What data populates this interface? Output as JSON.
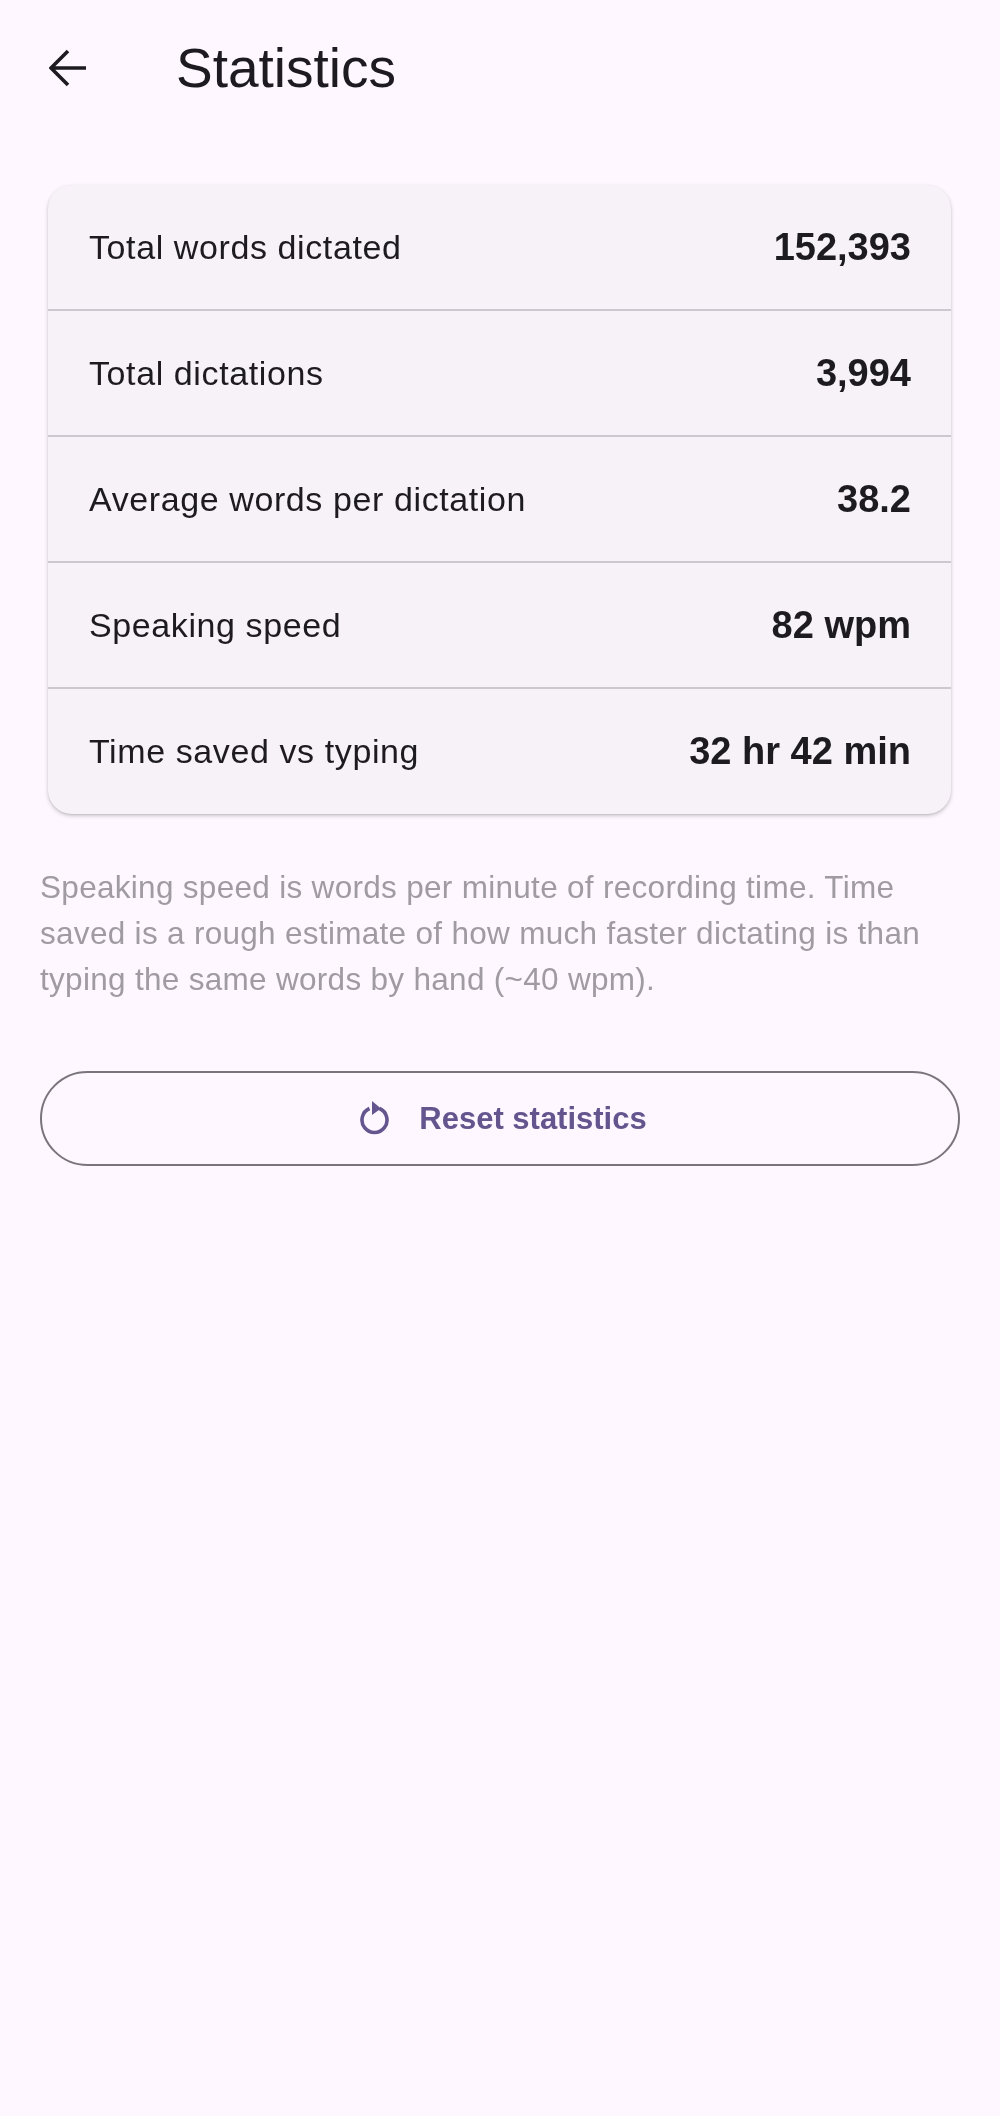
{
  "header": {
    "title": "Statistics"
  },
  "stats": [
    {
      "label": "Total words dictated",
      "value": "152,393"
    },
    {
      "label": "Total dictations",
      "value": "3,994"
    },
    {
      "label": "Average words per dictation",
      "value": "38.2"
    },
    {
      "label": "Speaking speed",
      "value": "82 wpm"
    },
    {
      "label": "Time saved vs typing",
      "value": "32 hr 42 min"
    }
  ],
  "note": "Speaking speed is words per minute of recording time. Time saved is a rough estimate of how much faster dictating is than typing the same words by hand (~40 wpm).",
  "reset_button": {
    "label": "Reset statistics"
  }
}
